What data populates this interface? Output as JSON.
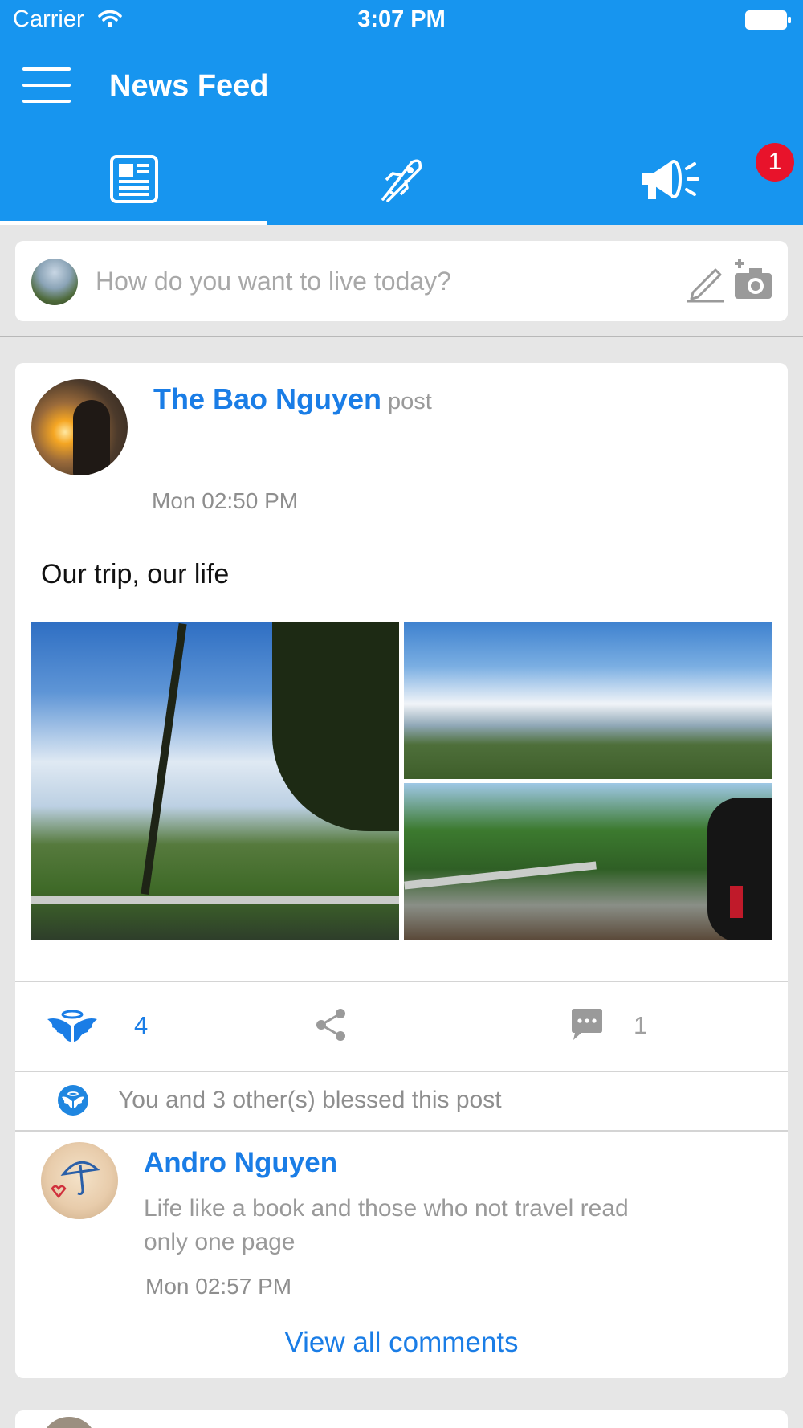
{
  "status_bar": {
    "carrier": "Carrier",
    "time": "3:07 PM",
    "icons": [
      "wifi-icon",
      "battery-icon"
    ]
  },
  "header": {
    "title": "News Feed",
    "menu_icon": "hamburger-menu-icon",
    "background_color": "#1795ef"
  },
  "tabs": [
    {
      "name": "news-feed",
      "icon": "newspaper-icon",
      "active": true
    },
    {
      "name": "rocket",
      "icon": "rocket-icon",
      "active": false
    },
    {
      "name": "announcements",
      "icon": "megaphone-icon",
      "active": false,
      "badge": "1"
    }
  ],
  "composer": {
    "placeholder": "How do you want to live today?",
    "icons": [
      "pencil-icon",
      "add-photo-icon"
    ]
  },
  "post": {
    "author": "The Bao Nguyen",
    "action": "post",
    "time": "Mon 02:50 PM",
    "text": "Our trip, our life",
    "photos_count": 3,
    "bless_count": "4",
    "comment_count": "1",
    "blessed_summary": "You and 3 other(s) blessed this post",
    "comment": {
      "author": "Andro Nguyen",
      "text": "Life like a book and those who not travel read only one page",
      "time": "Mon 02:57 PM"
    },
    "view_all_label": "View all comments"
  },
  "colors": {
    "accent": "#1a7de6",
    "badge": "#e8132b",
    "background": "#e6e6e6"
  }
}
